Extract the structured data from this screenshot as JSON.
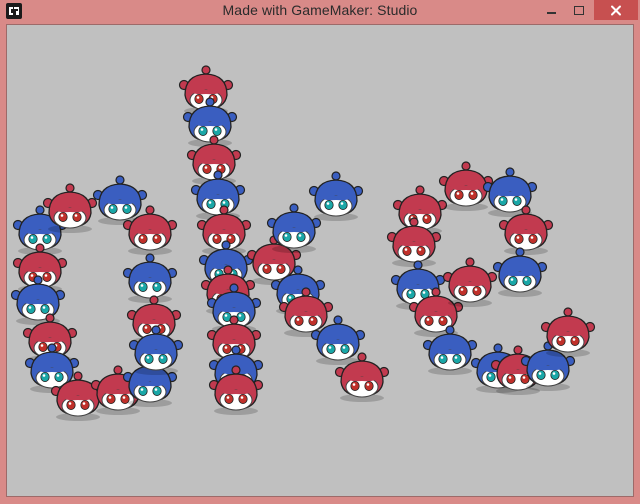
{
  "window": {
    "title": "Made with GameMaker: Studio",
    "app_icon": "gamemaker-icon",
    "controls": [
      "minimize-icon",
      "maximize-icon",
      "close-icon"
    ]
  },
  "game": {
    "background": "#c0c0c0",
    "spritesheet": {
      "red": "#c23a4f",
      "blue": "#3a5ec0",
      "face": "#ffffff",
      "eye_red": "#c0302a",
      "eye_teal": "#1aa7a7"
    },
    "word": "oke",
    "blobs": [
      {
        "c": "blue"
      },
      {
        "c": "red"
      },
      {
        "c": "blue"
      },
      {
        "c": "red"
      },
      {
        "c": "blue"
      },
      {
        "c": "red"
      },
      {
        "c": "blue"
      },
      {
        "c": "red"
      },
      {
        "c": "blue"
      },
      {
        "c": "red"
      },
      {
        "c": "red"
      },
      {
        "c": "blue"
      },
      {
        "c": "red"
      },
      {
        "c": "blue"
      },
      {
        "c": "red"
      },
      {
        "c": "blue"
      },
      {
        "c": "red"
      },
      {
        "c": "blue"
      },
      {
        "c": "red"
      },
      {
        "c": "blue"
      },
      {
        "c": "red"
      },
      {
        "c": "blue"
      },
      {
        "c": "red"
      },
      {
        "c": "blue"
      },
      {
        "c": "red"
      },
      {
        "c": "red"
      },
      {
        "c": "blue"
      },
      {
        "c": "blue"
      },
      {
        "c": "red"
      },
      {
        "c": "blue"
      },
      {
        "c": "red"
      },
      {
        "c": "blue"
      },
      {
        "c": "red"
      },
      {
        "c": "red"
      },
      {
        "c": "blue"
      },
      {
        "c": "red"
      },
      {
        "c": "blue"
      },
      {
        "c": "red"
      },
      {
        "c": "blue"
      },
      {
        "c": "red"
      },
      {
        "c": "blue"
      },
      {
        "c": "red"
      },
      {
        "c": "blue"
      },
      {
        "c": "red"
      },
      {
        "c": "blue"
      },
      {
        "c": "red"
      },
      {
        "c": "blue"
      },
      {
        "c": "red"
      },
      {
        "c": "blue"
      },
      {
        "c": "red"
      },
      {
        "c": "blue"
      },
      {
        "c": "red"
      },
      {
        "c": "blue"
      },
      {
        "c": "red"
      },
      {
        "c": "blue"
      },
      {
        "c": "red"
      },
      {
        "c": "blue"
      }
    ]
  }
}
